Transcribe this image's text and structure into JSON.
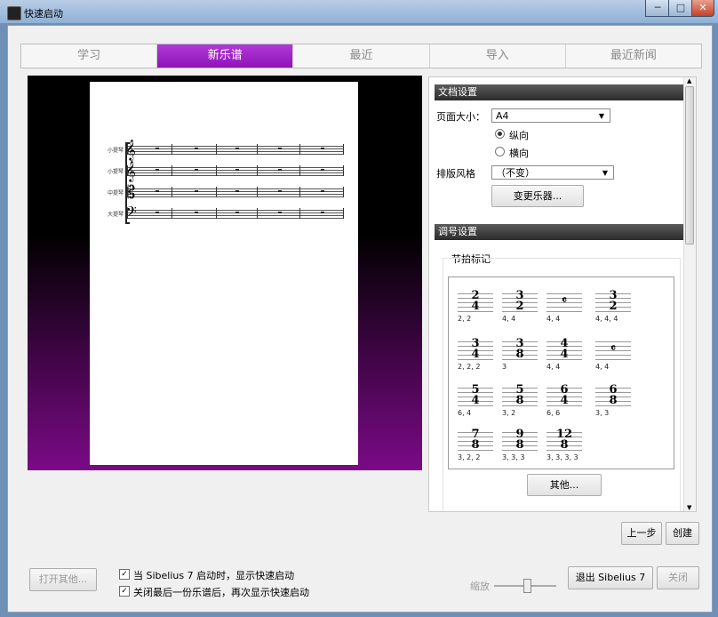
{
  "window": {
    "title": "快速启动",
    "controls": [
      "minimize-icon",
      "maximize-icon",
      "close-icon"
    ]
  },
  "tabs": [
    {
      "label": "学习",
      "active": false
    },
    {
      "label": "新乐谱",
      "active": true
    },
    {
      "label": "最近",
      "active": false
    },
    {
      "label": "导入",
      "active": false
    },
    {
      "label": "最近新闻",
      "active": false
    }
  ],
  "preview": {
    "staves": [
      {
        "name": "小提琴",
        "clef": "𝄞"
      },
      {
        "name": "小提琴",
        "clef": "𝄞"
      },
      {
        "name": "中提琴",
        "clef": "𝄡"
      },
      {
        "name": "大提琴",
        "clef": "𝄢"
      }
    ]
  },
  "document_settings": {
    "header": "文档设置",
    "page_size_label": "页面大小：",
    "page_size_value": "A4",
    "portrait_label": "纵向",
    "landscape_label": "横向",
    "orientation_selected": "portrait",
    "house_style_label": "排版风格",
    "house_style_value": "（不变）",
    "change_instruments_label": "变更乐器..."
  },
  "key_settings": {
    "header": "调号设置",
    "time_sig_label": "节拍标记",
    "time_signatures": [
      {
        "top": "2",
        "bottom": "4",
        "group": "2, 2"
      },
      {
        "top": "3",
        "bottom": "2",
        "group": "4, 4"
      },
      {
        "top": "𝄴",
        "bottom": "",
        "group": "4, 4"
      },
      {
        "top": "3",
        "bottom": "2",
        "group": "4, 4, 4"
      },
      {
        "top": "3",
        "bottom": "4",
        "group": "2, 2, 2"
      },
      {
        "top": "3",
        "bottom": "8",
        "group": "3"
      },
      {
        "top": "4",
        "bottom": "4",
        "group": "4, 4"
      },
      {
        "top": "𝄴",
        "bottom": "",
        "group": "4, 4"
      },
      {
        "top": "5",
        "bottom": "4",
        "group": "6, 4"
      },
      {
        "top": "5",
        "bottom": "8",
        "group": "3, 2"
      },
      {
        "top": "6",
        "bottom": "4",
        "group": "6, 6"
      },
      {
        "top": "6",
        "bottom": "8",
        "group": "3, 3"
      },
      {
        "top": "7",
        "bottom": "8",
        "group": "3, 2, 2"
      },
      {
        "top": "9",
        "bottom": "8",
        "group": "3, 3, 3"
      },
      {
        "top": "12",
        "bottom": "8",
        "group": "3, 3, 3, 3"
      }
    ],
    "other_label": "其他..."
  },
  "nav": {
    "back_label": "上一步",
    "create_label": "创建"
  },
  "footer": {
    "open_other_label": "打开其他...",
    "check1_label": "当 Sibelius 7 启动时，显示快速启动",
    "check1_checked": true,
    "check2_label": "关闭最后一份乐谱后，再次显示快速启动",
    "check2_checked": true,
    "zoom_label": "缩放",
    "exit_label": "退出 Sibelius 7",
    "close_label": "关闭"
  }
}
